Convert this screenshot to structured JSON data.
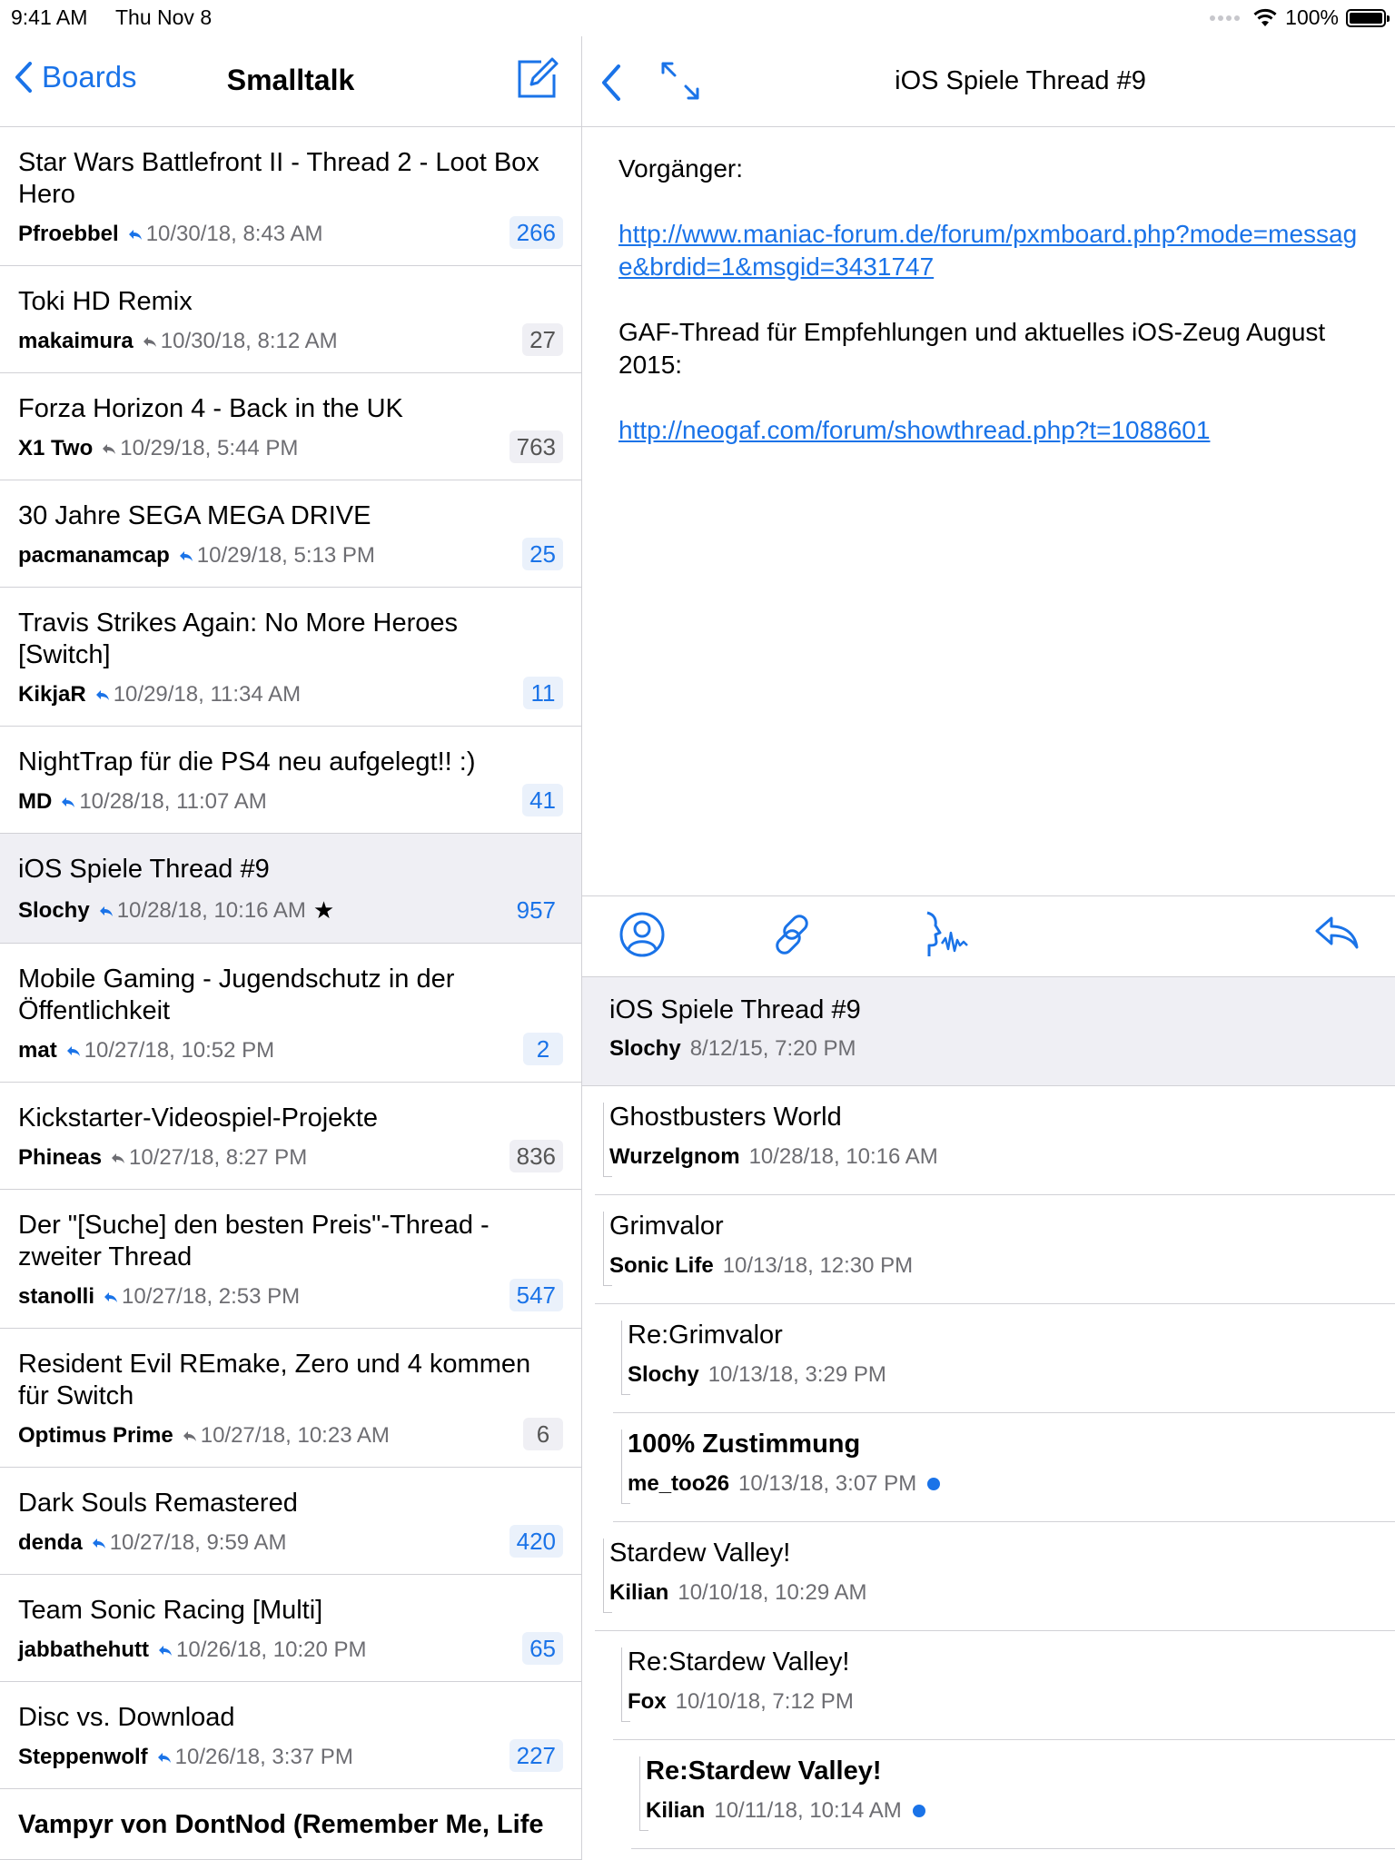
{
  "status": {
    "time": "9:41 AM",
    "date": "Thu Nov 8",
    "battery": "100%"
  },
  "colors": {
    "accent": "#1a73e8",
    "separator": "#d1d1d6",
    "selected_bg": "#efeff4"
  },
  "master": {
    "back_label": "Boards",
    "title": "Smalltalk",
    "threads": [
      {
        "title": "Star Wars Battlefront II - Thread 2 - Loot Box Hero",
        "author": "Pfroebbel",
        "date": "10/30/18, 8:43 AM",
        "count": "266",
        "state": "unread"
      },
      {
        "title": "Toki HD Remix",
        "author": "makaimura",
        "date": "10/30/18, 8:12 AM",
        "count": "27",
        "state": "read"
      },
      {
        "title": "Forza Horizon 4 - Back in the UK",
        "author": "X1 Two",
        "date": "10/29/18, 5:44 PM",
        "count": "763",
        "state": "read"
      },
      {
        "title": "30 Jahre SEGA MEGA DRIVE",
        "author": "pacmanamcap",
        "date": "10/29/18, 5:13 PM",
        "count": "25",
        "state": "unread"
      },
      {
        "title": "Travis Strikes Again: No More Heroes [Switch]",
        "author": "KikjaR",
        "date": "10/29/18, 11:34 AM",
        "count": "11",
        "state": "unread"
      },
      {
        "title": "NightTrap für die PS4 neu aufgelegt!! :)",
        "author": "MD",
        "date": "10/28/18, 11:07 AM",
        "count": "41",
        "state": "unread"
      },
      {
        "title": "iOS Spiele Thread #9",
        "author": "Slochy",
        "date": "10/28/18, 10:16 AM",
        "count": "957",
        "state": "selected",
        "star": "★"
      },
      {
        "title": "Mobile Gaming - Jugendschutz in der Öffentlichkeit",
        "author": "mat",
        "date": "10/27/18, 10:52 PM",
        "count": "2",
        "state": "unread"
      },
      {
        "title": "Kickstarter-Videospiel-Projekte",
        "author": "Phineas",
        "date": "10/27/18, 8:27 PM",
        "count": "836",
        "state": "read"
      },
      {
        "title": "Der \"[Suche] den besten Preis\"-Thread - zweiter Thread",
        "author": "stanolli",
        "date": "10/27/18, 2:53 PM",
        "count": "547",
        "state": "unread"
      },
      {
        "title": "Resident Evil REmake, Zero und 4 kommen für Switch",
        "author": "Optimus Prime",
        "date": "10/27/18, 10:23 AM",
        "count": "6",
        "state": "read"
      },
      {
        "title": "Dark Souls Remastered",
        "author": "denda",
        "date": "10/27/18, 9:59 AM",
        "count": "420",
        "state": "unread"
      },
      {
        "title": "Team Sonic Racing [Multi]",
        "author": "jabbathehutt",
        "date": "10/26/18, 10:20 PM",
        "count": "65",
        "state": "unread"
      },
      {
        "title": "Disc vs. Download",
        "author": "Steppenwolf",
        "date": "10/26/18, 3:37 PM",
        "count": "227",
        "state": "unread"
      }
    ],
    "partial_title": "Vampyr von DontNod (Remember Me, Life"
  },
  "detail": {
    "title": "iOS Spiele Thread #9",
    "body": {
      "p1": "Vorgänger:",
      "link1": "http://www.maniac-forum.de/forum/pxmboard.php?mode=message&brdid=1&msgid=3431747",
      "p2": "GAF-Thread für Empfehlungen und aktuelles iOS-Zeug August 2015:",
      "link2": "http://neogaf.com/forum/showthread.php?t=1088601"
    },
    "root": {
      "title": "iOS Spiele Thread #9",
      "author": "Slochy",
      "date": "8/12/15, 7:20 PM"
    },
    "replies": [
      {
        "title": "Ghostbusters World",
        "author": "Wurzelgnom",
        "date": "10/28/18, 10:16 AM",
        "level": 0,
        "bold": false,
        "unread": false
      },
      {
        "title": "Grimvalor",
        "author": "Sonic Life",
        "date": "10/13/18, 12:30 PM",
        "level": 0,
        "bold": false,
        "unread": false
      },
      {
        "title": "Re:Grimvalor",
        "author": "Slochy",
        "date": "10/13/18, 3:29 PM",
        "level": 1,
        "bold": false,
        "unread": false
      },
      {
        "title": "100% Zustimmung",
        "author": "me_too26",
        "date": "10/13/18, 3:07 PM",
        "level": 1,
        "bold": true,
        "unread": true
      },
      {
        "title": "Stardew Valley!",
        "author": "Kilian",
        "date": "10/10/18, 10:29 AM",
        "level": 0,
        "bold": false,
        "unread": false
      },
      {
        "title": "Re:Stardew Valley!",
        "author": "Fox",
        "date": "10/10/18, 7:12 PM",
        "level": 1,
        "bold": false,
        "unread": false
      },
      {
        "title": "Re:Stardew Valley!",
        "author": "Kilian",
        "date": "10/11/18, 10:14 AM",
        "level": 2,
        "bold": true,
        "unread": true
      }
    ]
  }
}
